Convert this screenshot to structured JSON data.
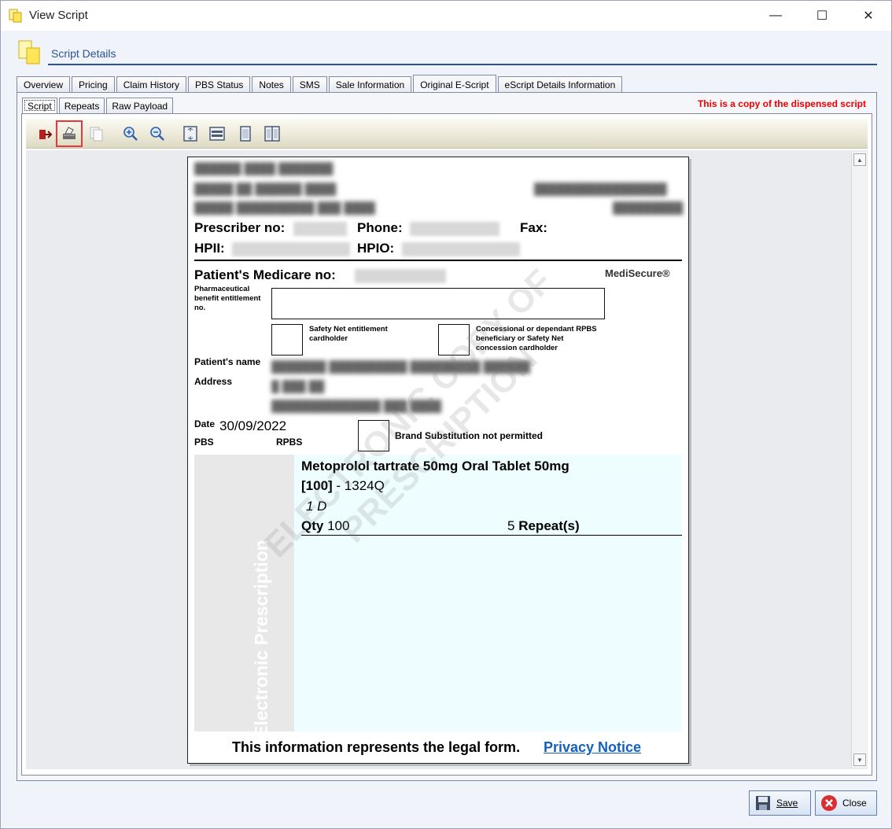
{
  "window": {
    "title": "View Script",
    "minimize": "—",
    "maximize": "☐",
    "close": "✕"
  },
  "header": {
    "title": "Script Details"
  },
  "tabs": [
    "Overview",
    "Pricing",
    "Claim History",
    "PBS Status",
    "Notes",
    "SMS",
    "Sale Information",
    "Original E-Script",
    "eScript Details Information"
  ],
  "selected_tab": "Original E-Script",
  "subtabs": [
    "Script",
    "Repeats",
    "Raw Payload"
  ],
  "selected_subtab": "Script",
  "copy_note": "This is a copy of the dispensed script",
  "toolbar": {
    "icons": [
      "export-icon",
      "print-icon",
      "copy-icon",
      "zoom-in-icon",
      "zoom-out-icon",
      "fit-page-icon",
      "fit-width-icon",
      "single-page-icon",
      "two-page-icon"
    ],
    "highlighted": "print-icon"
  },
  "document": {
    "prescriber_no_label": "Prescriber no:",
    "phone_label": "Phone:",
    "fax_label": "Fax:",
    "hpii_label": "HPII:",
    "hpio_label": "HPIO:",
    "medicare_label": "Patient's Medicare no:",
    "brand": "MediSecure®",
    "pbe_label": "Pharmaceutical benefit entitlement no.",
    "safety_net_label": "Safety Net entitlement cardholder",
    "concessional_label": "Concessional or dependant RPBS beneficiary or Safety Net concession cardholder",
    "patient_name_label": "Patient's name",
    "address_label": "Address",
    "date_label": "Date",
    "date_value": "30/09/2022",
    "pbs_label": "PBS",
    "rpbs_label": "RPBS",
    "brand_sub_label": "Brand Substitution not permitted",
    "side_text": "Electronic Prescription",
    "watermark_line1": "ELECTRONIC COPY OF",
    "watermark_line2": "PRESCRIPTION",
    "drug_name": "Metoprolol tartrate 50mg Oral Tablet 50mg",
    "drug_qty_bracket": "[100]",
    "drug_code": " - 1324Q",
    "dosage": "1 D",
    "qty_label": "Qty",
    "qty_value": "100",
    "repeats_value": "5",
    "repeats_label": "Repeat(s)",
    "footer_text": "This information represents the legal form.",
    "privacy_link": "Privacy Notice"
  },
  "buttons": {
    "save": "Save",
    "close": "Close"
  },
  "colors": {
    "accent": "#2b5197",
    "warning": "#e00000",
    "rx_bg": "#eefdff",
    "link": "#1560bd"
  }
}
